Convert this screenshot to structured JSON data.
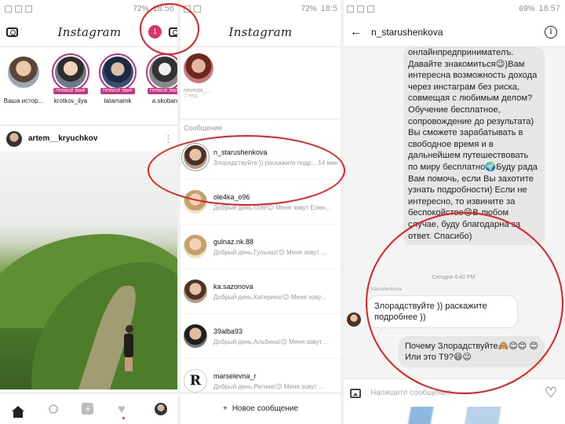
{
  "panel1": {
    "status": {
      "battery": "72%",
      "time": "18:56"
    },
    "app_title": "Instagram",
    "notification_count": "1",
    "stories": [
      {
        "name": "Ваша истор...",
        "live": ""
      },
      {
        "name": "krotkov_ilya",
        "live": "ПРЯМОЙ ЭФИР"
      },
      {
        "name": "tatamamk",
        "live": "ПРЯМОЙ ЭФИР"
      },
      {
        "name": "a.skoban",
        "live": "ПРЯМОЙ ЭФИР"
      }
    ],
    "post_user": "artem__kryuchkov"
  },
  "panel2": {
    "status": {
      "battery": "72%",
      "time": "18:5"
    },
    "app_title": "Instagram",
    "story_name": "nevesta_...",
    "story_sub": "7 нед",
    "section_title": "Сообщения",
    "conversations": [
      {
        "user": "n_starushenkova",
        "preview": "Злорадствуйте )) раскажите подр...",
        "time": "14 мин"
      },
      {
        "user": "ole4ka_o96",
        "preview": "Добрый день,Оля!😉 Меня зовут Елен..."
      },
      {
        "user": "gulnaz.nk.88",
        "preview": "Добрый день,Гульназ!😉 Меня зовут ..."
      },
      {
        "user": "ka.sazonova",
        "preview": "Добрый день,Катерина!😉 Меня зову..."
      },
      {
        "user": "39alba93",
        "preview": "Добрый день,Альбина!😉 Меня зовут ..."
      },
      {
        "user": "marselevna_r",
        "preview": "Добрый день,Регина!😉 Меня зовут ..."
      }
    ],
    "new_message": "Новое сообщение",
    "r_letter": "R"
  },
  "panel3": {
    "status": {
      "battery": "69%",
      "time": "18:57"
    },
    "chat_title": "n_starushenkova",
    "incoming_long": "онлайнпредпринимателъ. Давайте знакомиться😉)Вам интересна возможность дохода через инстаграм без риска, совмещая с любимым делом? Обучение бесплатное, сопровождение до результата) Вы сможете зарабатывать в свободное время и в дальнейшем путешествовать по миру бесплатно🌍Буду рада Вам помочь, если Вы захотите узнать подробности) Если не интересно, то извините за беспокойство😉В любом случае, буду благодарна за ответ. Спасибо)",
    "timestamp": "Сегодня 6:42 PM",
    "from_name": "n_starushenkova",
    "reply_in": "Злорадствуйте )) раскажите подробнее ))",
    "reply_out": "Почему Злорадствуйте🙈😊😊 😊Или это Т9?😄😉",
    "composer_placeholder": "Напишите сообщение..."
  },
  "colors": {
    "accent": "#e1306c",
    "ring": "#c13584",
    "annotation": "#e51e1e"
  }
}
